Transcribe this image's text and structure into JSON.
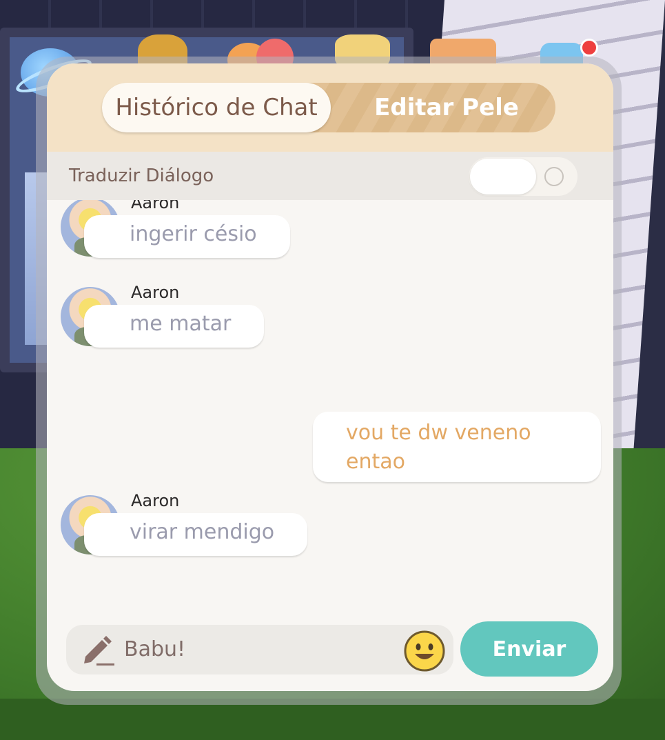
{
  "tabs": [
    {
      "label": "Histórico de Chat",
      "active": true
    },
    {
      "label": "Editar Pele",
      "active": false
    }
  ],
  "translate": {
    "label": "Traduzir Diálogo",
    "enabled": false
  },
  "messages": [
    {
      "sender": "Aaron",
      "text": "ingerir césio",
      "direction": "incoming"
    },
    {
      "sender": "Aaron",
      "text": "me matar",
      "direction": "incoming"
    },
    {
      "sender": "",
      "text": "vou te dw veneno entao",
      "direction": "outgoing"
    },
    {
      "sender": "Aaron",
      "text": "virar mendigo",
      "direction": "incoming"
    }
  ],
  "input": {
    "value": "Babu!"
  },
  "send": {
    "label": "Enviar"
  },
  "colors": {
    "header": "#f4e2c6",
    "tab_track": "#e2c195",
    "send_button": "#62c7be",
    "outgoing_text": "#e3a864",
    "incoming_text": "#9a9bad",
    "notification": "#ee3f3f"
  }
}
